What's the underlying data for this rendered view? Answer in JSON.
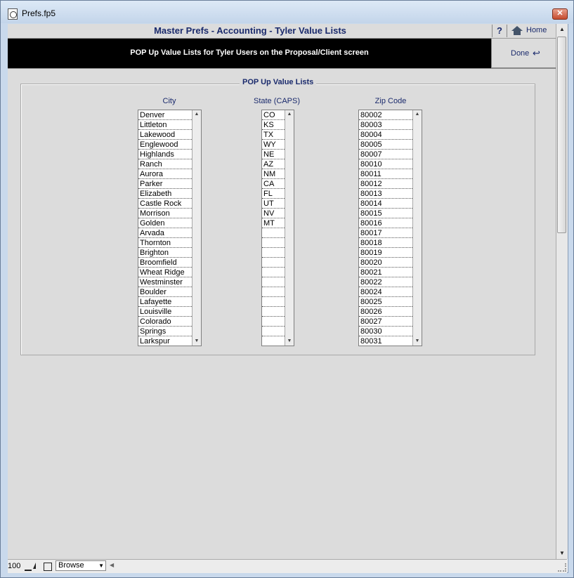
{
  "window": {
    "title": "Prefs.fp5",
    "close_glyph": "✕"
  },
  "header": {
    "title": "Master Prefs - Accounting - Tyler Value Lists",
    "help_label": "?",
    "home_label": "Home",
    "banner": "POP Up Value Lists for Tyler Users on the Proposal/Client screen",
    "done_label": "Done",
    "done_icon": "↩"
  },
  "group": {
    "title": "POP Up Value Lists"
  },
  "lists": {
    "city": {
      "heading": "City",
      "items": [
        "Denver",
        "Littleton",
        "Lakewood",
        "Englewood",
        "Highlands",
        "Ranch",
        "Aurora",
        "Parker",
        "Elizabeth",
        "Castle Rock",
        "Morrison",
        "Golden",
        "Arvada",
        "Thornton",
        "Brighton",
        "Broomfield",
        "Wheat Ridge",
        "Westminster",
        "Boulder",
        "Lafayette",
        "Louisville",
        "Colorado",
        "Springs",
        "Larkspur"
      ]
    },
    "state": {
      "heading": "State (CAPS)",
      "items": [
        "CO",
        "KS",
        "TX",
        "WY",
        "NE",
        "AZ",
        "NM",
        "CA",
        "FL",
        "UT",
        "NV",
        "MT",
        "",
        "",
        "",
        "",
        "",
        "",
        "",
        "",
        "",
        "",
        "",
        ""
      ]
    },
    "zip": {
      "heading": "Zip Code",
      "items": [
        "80002",
        "80003",
        "80004",
        "80005",
        "80007",
        "80010",
        "80011",
        "80012",
        "80013",
        "80014",
        "80015",
        "80016",
        "80017",
        "80018",
        "80019",
        "80020",
        "80021",
        "80022",
        "80024",
        "80025",
        "80026",
        "80027",
        "80030",
        "80031"
      ]
    }
  },
  "statusbar": {
    "zoom": "100",
    "mode": "Browse"
  },
  "icons": {
    "scroll_up": "▲",
    "scroll_down": "▼",
    "dropdown": "▼",
    "scroll_left": "◀"
  }
}
